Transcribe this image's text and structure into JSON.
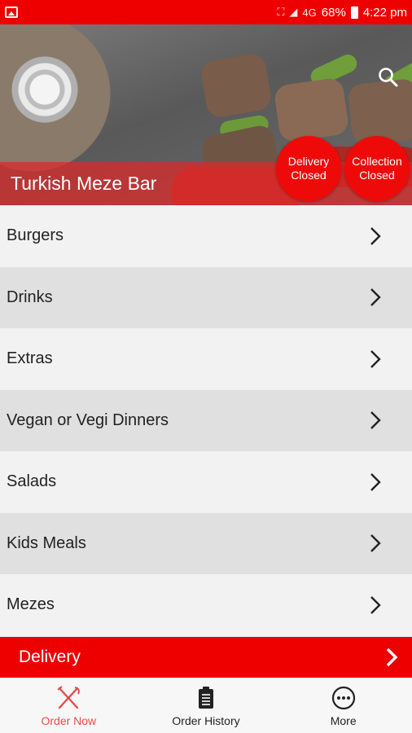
{
  "status_bar": {
    "network": "4G",
    "battery": "68%",
    "time": "4:22 pm"
  },
  "header": {
    "restaurant_name": "Turkish Meze Bar",
    "search_icon": "search-icon",
    "delivery_badge": "Delivery Closed",
    "collection_badge": "Collection Closed"
  },
  "categories": [
    {
      "label": "Burgers"
    },
    {
      "label": "Drinks"
    },
    {
      "label": "Extras"
    },
    {
      "label": "Vegan or Vegi Dinners"
    },
    {
      "label": "Salads"
    },
    {
      "label": "Kids Meals"
    },
    {
      "label": "Mezes"
    }
  ],
  "delivery_bar": {
    "label": "Delivery"
  },
  "bottom_nav": {
    "items": [
      {
        "label": "Order Now",
        "icon": "fork-knife-icon",
        "active": true
      },
      {
        "label": "Order History",
        "icon": "clipboard-icon",
        "active": false
      },
      {
        "label": "More",
        "icon": "more-icon",
        "active": false
      }
    ]
  },
  "colors": {
    "accent": "#ef0000",
    "active_nav": "#e84a4a"
  }
}
